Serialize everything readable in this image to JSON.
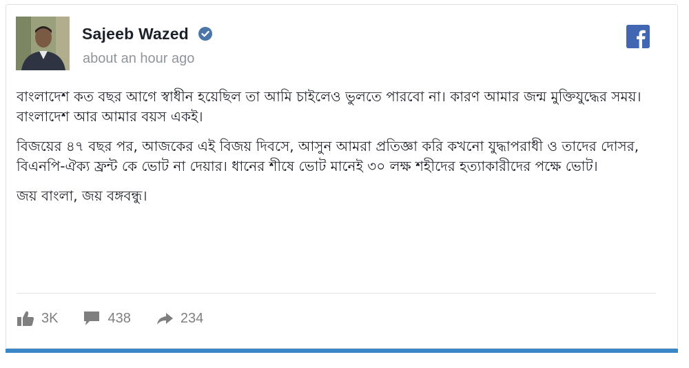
{
  "post": {
    "author": "Sajeeb Wazed",
    "verified": true,
    "timestamp": "about an hour ago",
    "paragraphs": [
      "বাংলাদেশ কত বছর আগে স্বাধীন হয়েছিল তা আমি চাইলেও ভুলতে পারবো না। কারণ আমার জন্ম মুক্তিযুদ্ধের সময়। বাংলাদেশ আর আমার বয়স একই।",
      "বিজয়ের ৪৭ বছর পর, আজকের এই বিজয় দিবসে, আসুন আমরা প্রতিজ্ঞা করি কখনো যুদ্ধাপরাধী ও তাদের দোসর, বিএনপি-ঐক্য ফ্রন্ট কে ভোট না দেয়ার। ধানের শীষে ভোট মানেই ৩০ লক্ষ শহীদের হত্যাকারীদের পক্ষে ভোট।",
      "জয় বাংলা, জয় বঙ্গবন্ধু।"
    ]
  },
  "stats": {
    "likes": "3K",
    "comments": "438",
    "shares": "234"
  },
  "icons": {
    "platform": "facebook-icon",
    "like": "thumbs-up-icon",
    "comment": "comment-bubble-icon",
    "share": "share-arrow-icon",
    "verified": "verified-badge-icon"
  },
  "colors": {
    "facebook_blue": "#4267b2",
    "verified_blue": "#4a76a8",
    "bottom_bar": "#3b86c7",
    "meta_gray": "#90949c"
  }
}
